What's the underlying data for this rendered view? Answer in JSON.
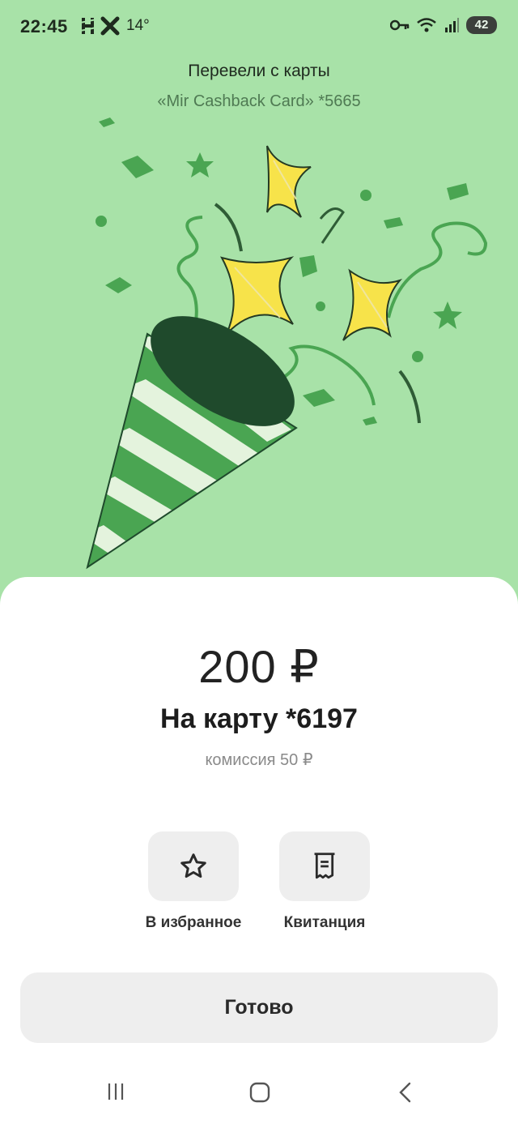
{
  "status_bar": {
    "time": "22:45",
    "temperature": "14°",
    "battery": "42",
    "icons": [
      "h-icon",
      "x-icon",
      "key-icon",
      "wifi-icon",
      "signal-icon"
    ]
  },
  "header": {
    "title": "Перевели с карты",
    "card": "«Mir Cashback Card» *5665"
  },
  "transfer": {
    "amount": "200 ₽",
    "recipient": "На карту *6197",
    "fee": "комиссия 50 ₽"
  },
  "actions": {
    "favorite_label": "В избранное",
    "receipt_label": "Квитанция"
  },
  "done_label": "Готово",
  "colors": {
    "background": "#a8e2a8",
    "accent_green": "#4aa552",
    "dark_green": "#1f4a2c",
    "star_yellow": "#f7e34a"
  }
}
